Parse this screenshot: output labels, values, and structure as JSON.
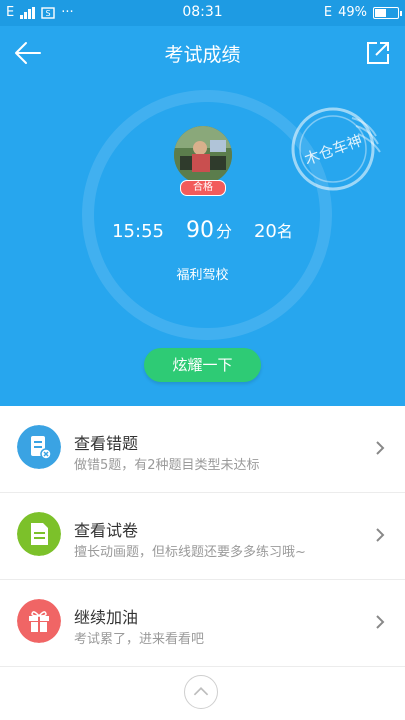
{
  "status_bar": {
    "carrier": "E",
    "time": "08:31",
    "right_network": "E",
    "battery": "49%",
    "battery_level": 0.49,
    "dots": "···"
  },
  "header": {
    "title": "考试成绩"
  },
  "result": {
    "badge": "合格",
    "time": "15:55",
    "score": "90",
    "score_unit": "分",
    "rank": "20",
    "rank_unit": "名",
    "school": "福利驾校",
    "stamp_text": "木仓车神"
  },
  "share_button": "炫耀一下",
  "list": [
    {
      "label": "查看错题",
      "sub": "做错5题，有2种题目类型未达标",
      "icon": "wrong-questions-icon",
      "color": "#3aa3e3"
    },
    {
      "label": "查看试卷",
      "sub": "擅长动画题，但标线题还要多多练习哦~",
      "icon": "exam-paper-icon",
      "color": "#7cc12a"
    },
    {
      "label": "继续加油",
      "sub": "考试累了，进来看看吧",
      "icon": "gift-icon",
      "color": "#f06565"
    }
  ],
  "colors": {
    "hero": "#27a6ee",
    "status_bar": "#1e9be3",
    "button": "#2ecb75"
  }
}
